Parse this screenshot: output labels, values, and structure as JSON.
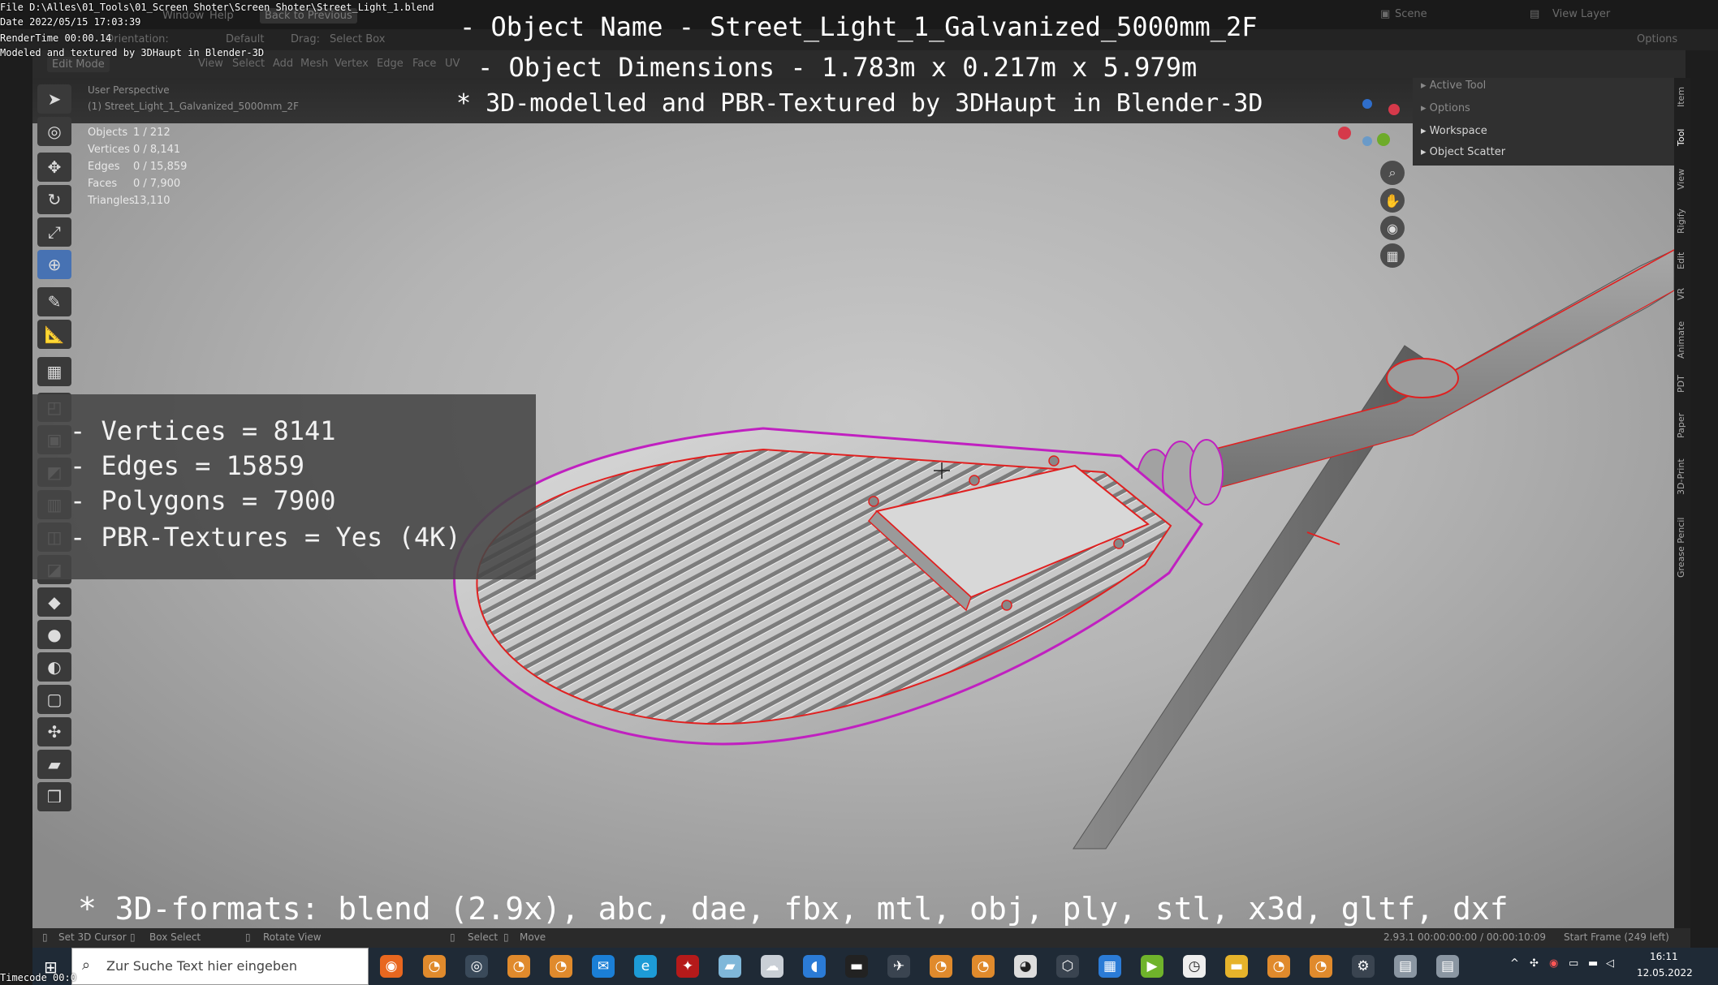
{
  "file_info": {
    "file": "File D:\\Alles\\01_Tools\\01_Screen Shoter\\Screen Shoter\\Street_Light_1.blend",
    "date": "Date 2022/05/15 17:03:39",
    "render_time": "RenderTime 00:00.14",
    "modeled_by": "Modeled and textured by 3DHaupt in Blender-3D",
    "timecode": "Timecode 00:0"
  },
  "title_overlay": {
    "line1": "- Object Name - Street_Light_1_Galvanized_5000mm_2F",
    "line2": "- Object Dimensions -  1.783m x 0.217m x 5.979m",
    "line3": "* 3D-modelled and PBR-Textured by 3DHaupt in Blender-3D"
  },
  "stats_box": {
    "vertices": "- Vertices = 8141",
    "edges": "- Edges = 15859",
    "polygons": "- Polygons = 7900",
    "textures": "- PBR-Textures =  Yes (4K)"
  },
  "formats_line": "* 3D-formats: blend (2.9x), abc, dae, fbx, mtl, obj, ply, stl, x3d, gltf, dxf",
  "header": {
    "scene": "Scene",
    "view_layer": "View Layer",
    "orientation": "Orientation:",
    "default": "Default",
    "drag": "Drag:",
    "select_box": "Select Box",
    "options": "Options",
    "edit_mode": "Edit Mode",
    "menus": [
      "View",
      "Select",
      "Add",
      "Mesh",
      "Vertex",
      "Edge",
      "Face",
      "UV"
    ],
    "window": "Window",
    "help": "Help",
    "back": "Back to Previous"
  },
  "viewport": {
    "perspective": "User Perspective",
    "object_path": "(1) Street_Light_1_Galvanized_5000mm_2F",
    "stats": [
      {
        "label": "Objects",
        "value": "1 / 212"
      },
      {
        "label": "Vertices",
        "value": "0 / 8,141"
      },
      {
        "label": "Edges",
        "value": "0 / 15,859"
      },
      {
        "label": "Faces",
        "value": "0 / 7,900"
      },
      {
        "label": "Triangles",
        "value": "13,110"
      }
    ]
  },
  "npanel": {
    "items": [
      "Active Tool",
      "Options",
      "Workspace",
      "Object Scatter"
    ]
  },
  "sidebar_tabs": [
    "Item",
    "Tool",
    "View",
    "Rigify",
    "Edit",
    "VR",
    "Animate",
    "PDT",
    "Paper",
    "3D-Print",
    "Grease Pencil"
  ],
  "statusbar": {
    "set_cursor": "Set 3D Cursor",
    "box_select": "Box Select",
    "rotate_view": "Rotate View",
    "select": "Select",
    "move": "Move",
    "version": "2.93.1  00:00:00:00 / 00:00:10:09",
    "start_frame": "Start Frame (249 left)"
  },
  "taskbar": {
    "search_placeholder": "Zur Suche Text hier eingeben",
    "time": "16:11",
    "date": "12.05.2022"
  },
  "colors": {
    "accent": "#4772b3",
    "edge_select": "#e02020",
    "edge_seam": "#c020c0",
    "taskbar": "#1f2a36"
  }
}
